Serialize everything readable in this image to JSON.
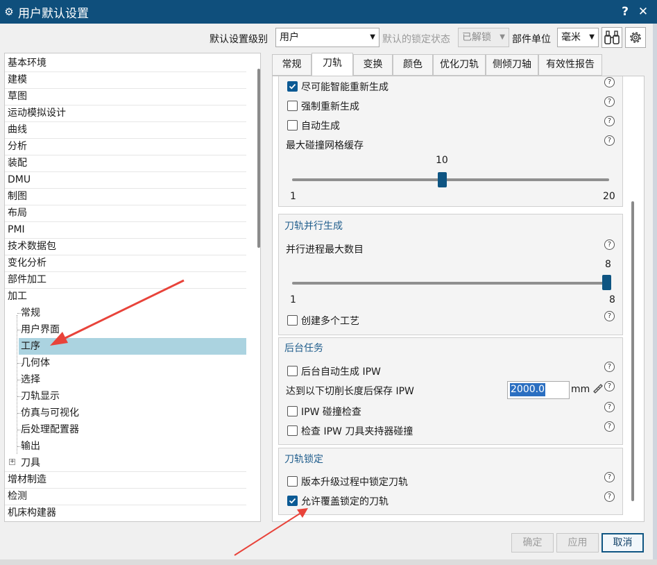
{
  "window": {
    "title": "用户默认设置",
    "help_label": "?",
    "close_label": "✕"
  },
  "toolbar": {
    "level_label": "默认设置级别",
    "level_value": "用户",
    "lock_label": "默认的锁定状态",
    "lock_value": "已解锁",
    "unit_label": "部件单位",
    "unit_value": "毫米"
  },
  "tree": {
    "items": [
      {
        "label": "基本环境"
      },
      {
        "label": "建模"
      },
      {
        "label": "草图"
      },
      {
        "label": "运动模拟设计"
      },
      {
        "label": "曲线"
      },
      {
        "label": "分析"
      },
      {
        "label": "装配"
      },
      {
        "label": "DMU"
      },
      {
        "label": "制图"
      },
      {
        "label": "布局"
      },
      {
        "label": "PMI"
      },
      {
        "label": "技术数据包"
      },
      {
        "label": "变化分析"
      },
      {
        "label": "部件加工"
      },
      {
        "label": "加工"
      },
      {
        "label": "常规"
      },
      {
        "label": "用户界面"
      },
      {
        "label": "工序"
      },
      {
        "label": "几何体"
      },
      {
        "label": "选择"
      },
      {
        "label": "刀轨显示"
      },
      {
        "label": "仿真与可视化"
      },
      {
        "label": "后处理配置器"
      },
      {
        "label": "输出"
      },
      {
        "label": "刀具"
      },
      {
        "label": "增材制造"
      },
      {
        "label": "检测"
      },
      {
        "label": "机床构建器"
      }
    ]
  },
  "tabs": [
    {
      "label": "常规"
    },
    {
      "label": "刀轨"
    },
    {
      "label": "变换"
    },
    {
      "label": "颜色"
    },
    {
      "label": "优化刀轨"
    },
    {
      "label": "侧倾刀轴"
    },
    {
      "label": "有效性报告"
    }
  ],
  "content": {
    "regen": {
      "smart_regen": "尽可能智能重新生成",
      "force_regen": "强制重新生成",
      "auto_gen": "自动生成",
      "cache_label": "最大碰撞网格缓存",
      "slider": {
        "value": "10",
        "min": "1",
        "max": "20",
        "fraction": 0.4737
      }
    },
    "parallel": {
      "title": "刀轨并行生成",
      "max_label": "并行进程最大数目",
      "slider": {
        "value": "8",
        "min": "1",
        "max": "8",
        "fraction": 1.0
      },
      "multi_op": "创建多个工艺"
    },
    "background": {
      "title": "后台任务",
      "auto_ipw": "后台自动生成 IPW",
      "save_ipw_label": "达到以下切削长度后保存 IPW",
      "save_ipw_value": "2000.0",
      "unit": "mm",
      "ipw_collision": "IPW 碰撞检查",
      "holder_collision": "检查 IPW 刀具夹持器碰撞"
    },
    "lock": {
      "title": "刀轨锁定",
      "lock_on_upgrade": "版本升级过程中锁定刀轨",
      "allow_override": "允许覆盖锁定的刀轨"
    }
  },
  "buttons": {
    "ok": "确定",
    "apply": "应用",
    "cancel": "取消"
  },
  "colors": {
    "titlebar": "#0f4f7c",
    "selection": "#abd3e0",
    "accent": "#0c5a94",
    "arrow": "#e8433a"
  }
}
